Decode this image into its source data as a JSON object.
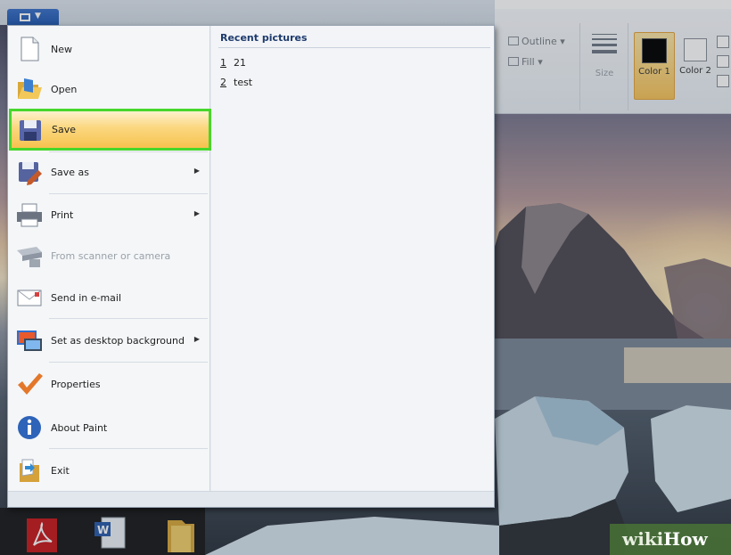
{
  "ribbon": {
    "outline_label": "Outline",
    "fill_label": "Fill",
    "size_label": "Size",
    "color1_label": "Color 1",
    "color2_label": "Color 2",
    "color1_value": "#000000",
    "color2_value": "#ffffff"
  },
  "app_menu": {
    "items": [
      {
        "label": "New",
        "icon": "new-file-icon"
      },
      {
        "label": "Open",
        "icon": "open-folder-icon"
      },
      {
        "label": "Save",
        "icon": "save-icon"
      },
      {
        "label": "Save as",
        "icon": "save-as-icon",
        "submenu": true
      },
      {
        "label": "Print",
        "icon": "printer-icon",
        "submenu": true
      },
      {
        "label": "From scanner or camera",
        "icon": "scanner-icon",
        "disabled": true
      },
      {
        "label": "Send in e-mail",
        "icon": "email-icon"
      },
      {
        "label": "Set as desktop background",
        "icon": "desktop-icon",
        "submenu": true
      },
      {
        "label": "Properties",
        "icon": "checkmark-icon"
      },
      {
        "label": "About Paint",
        "icon": "info-icon"
      },
      {
        "label": "Exit",
        "icon": "exit-icon"
      }
    ],
    "recent_title": "Recent pictures",
    "recent": [
      {
        "num": "1",
        "name": "21"
      },
      {
        "num": "2",
        "name": "test"
      }
    ]
  },
  "watermark": {
    "wiki": "wiki",
    "how": "How"
  },
  "colors": {
    "highlight_border": "#46d62b",
    "highlight_fill": "#fbd77f",
    "menu_button": "#2a5fb8"
  }
}
